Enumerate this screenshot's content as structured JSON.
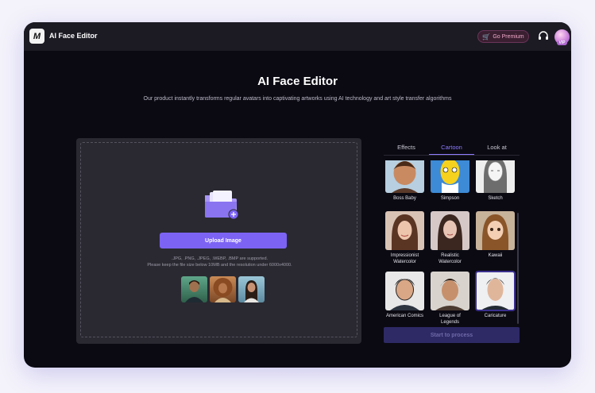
{
  "app": {
    "title": "AI Face Editor",
    "logo_text": "M"
  },
  "header": {
    "premium_label": "Go Premium",
    "premium_icon": "cart-icon",
    "support_icon": "headset-icon",
    "avatar_badge": "VIP"
  },
  "hero": {
    "title": "AI Face Editor",
    "subtitle": "Our product instantly transforms regular avatars into captivating artworks using AI technology and art style transfer algorithms"
  },
  "upload": {
    "button_label": "Upload Image",
    "formats_text": ".JPG, .PNG, .JPEG, .WEBP, .BMP are supported.",
    "limits_text": "Please keep the file size below 10MB and the resolution under 6000x4000."
  },
  "tabs": [
    {
      "label": "Effects",
      "active": false
    },
    {
      "label": "Cartoon",
      "active": true
    },
    {
      "label": "Look at",
      "active": false
    }
  ],
  "styles": [
    {
      "label": "Boss Baby"
    },
    {
      "label": "Simpson"
    },
    {
      "label": "Sketch"
    },
    {
      "label": "Impressionist Watercolor"
    },
    {
      "label": "Realistic Watercolor"
    },
    {
      "label": "Kawaii"
    },
    {
      "label": "American Comics"
    },
    {
      "label": "League of Legends"
    },
    {
      "label": "Caricature",
      "selected": true
    }
  ],
  "process_button_label": "Start to process",
  "colors": {
    "accent": "#7c63f4",
    "active_tab": "#8e7bff",
    "background": "#0b0a13"
  }
}
